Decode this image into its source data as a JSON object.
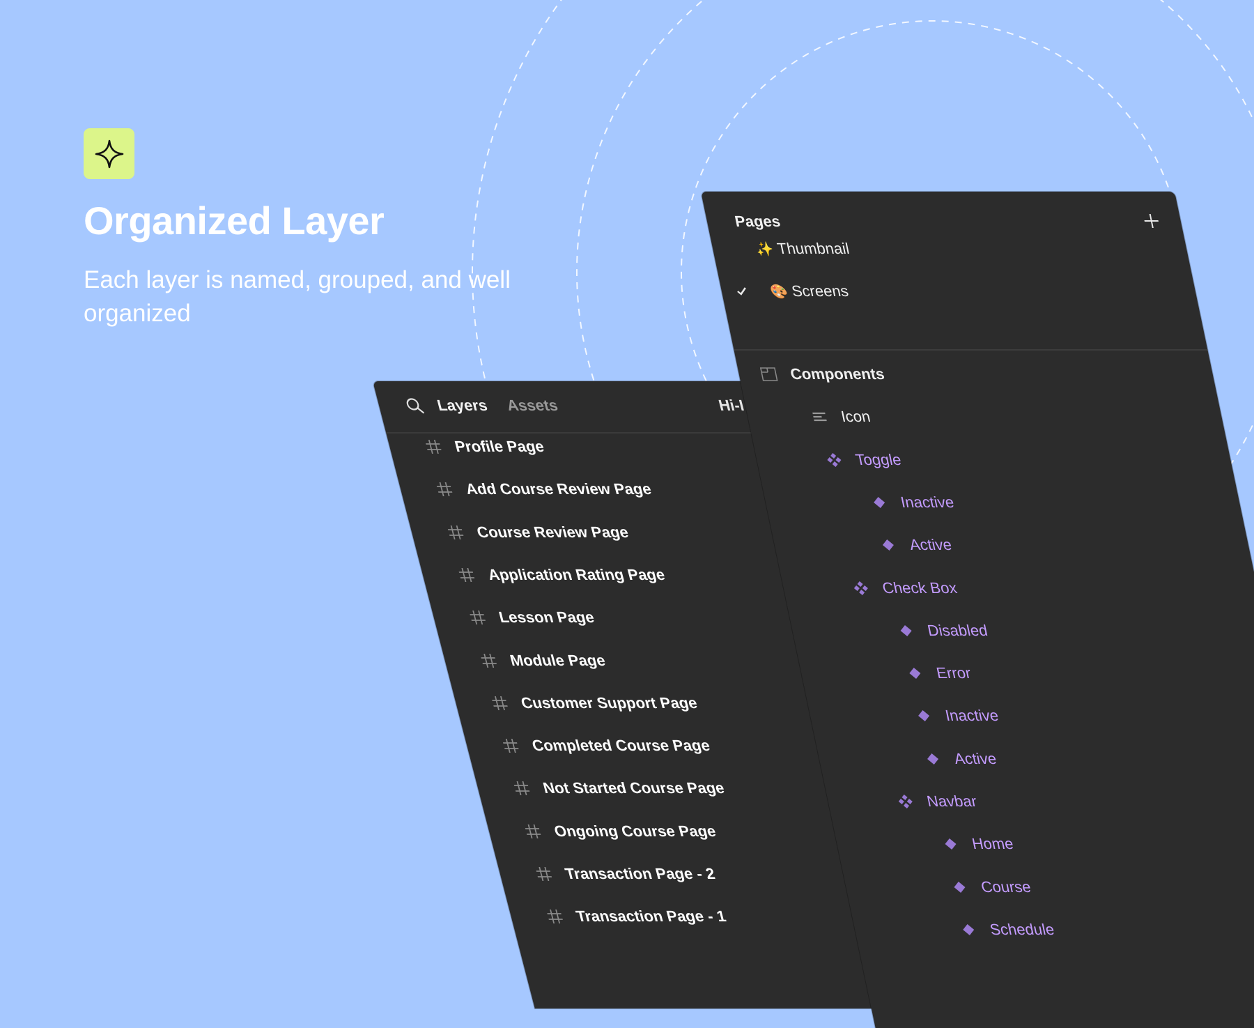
{
  "hero": {
    "title": "Organized Layer",
    "subtitle": "Each layer is named, grouped, and well organized",
    "badge_color": "#dcf58a",
    "badge_icon": "sparkle-star-icon"
  },
  "layers_panel": {
    "tab_layers": "Layers",
    "tab_assets": "Assets",
    "page_name_partial": "Hi-I",
    "items": [
      "Profile Page",
      "Add Course Review Page",
      "Course Review Page",
      "Application Rating Page",
      "Lesson Page",
      "Module Page",
      "Customer Support Page",
      "Completed Course Page",
      "Not Started Course Page",
      "Ongoing Course Page",
      "Transaction Page - 2",
      "Transaction Page - 1"
    ]
  },
  "pages_panel": {
    "title": "Pages",
    "pages": [
      {
        "emoji": "✨",
        "label": "Thumbnail",
        "selected": false
      },
      {
        "emoji": "🎨",
        "label": "Screens",
        "selected": true
      }
    ],
    "components": {
      "root": "Components",
      "items": [
        {
          "label": "Icon",
          "type": "frame"
        },
        {
          "label": "Toggle",
          "type": "component-set"
        },
        {
          "label": "Inactive",
          "type": "variant"
        },
        {
          "label": "Active",
          "type": "variant"
        },
        {
          "label": "Check Box",
          "type": "component-set"
        },
        {
          "label": "Disabled",
          "type": "variant"
        },
        {
          "label": "Error",
          "type": "variant"
        },
        {
          "label": "Inactive",
          "type": "variant"
        },
        {
          "label": "Active",
          "type": "variant"
        },
        {
          "label": "Navbar",
          "type": "component-set"
        },
        {
          "label": "Home",
          "type": "variant"
        },
        {
          "label": "Course",
          "type": "variant"
        },
        {
          "label": "Schedule",
          "type": "variant"
        }
      ]
    }
  },
  "colors": {
    "background": "#a6c8ff",
    "panel": "#2c2c2c",
    "component_text": "#c49cff",
    "component_icon": "#9a7ad6"
  }
}
